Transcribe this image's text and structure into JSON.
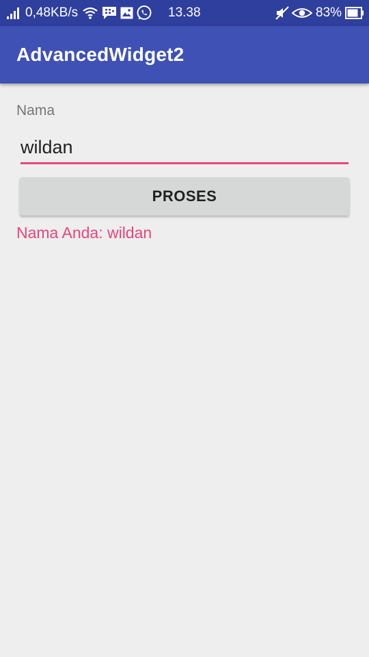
{
  "status_bar": {
    "net_speed": "0,48KB/s",
    "time": "13.38",
    "battery": "83%",
    "icons": [
      "signal-icon",
      "wifi-icon",
      "bbm-icon",
      "gallery-icon",
      "whatsapp-icon",
      "mute-icon",
      "eye-icon",
      "battery-icon"
    ]
  },
  "app_bar": {
    "title": "AdvancedWidget2"
  },
  "form": {
    "name_label": "Nama",
    "name_value": "wildan",
    "button_label": "PROSES",
    "result": "Nama Anda: wildan"
  },
  "colors": {
    "status_bar": "#2f3f9e",
    "app_bar": "#3f51b5",
    "accent": "#e8457c",
    "background": "#eeeeee",
    "button": "#d6d7d7"
  }
}
